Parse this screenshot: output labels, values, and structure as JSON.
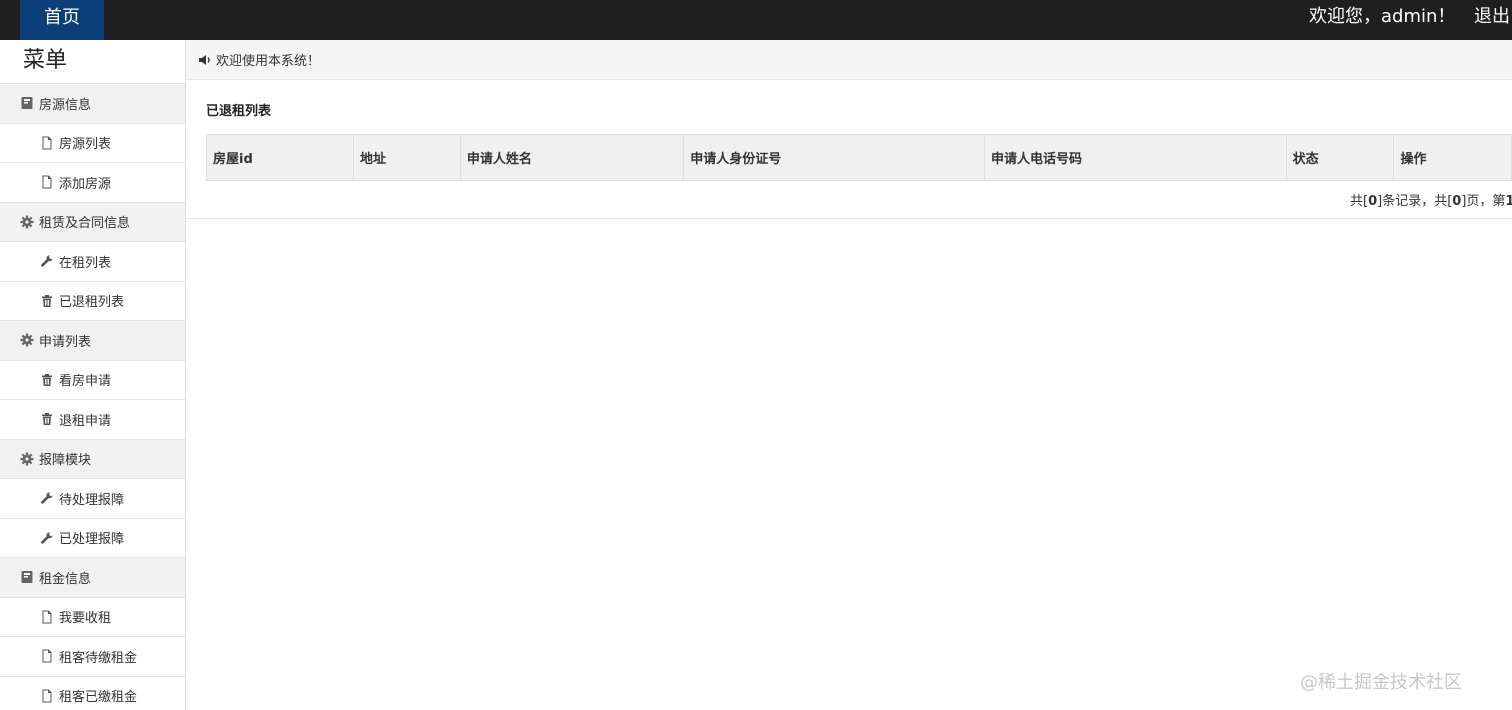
{
  "topbar": {
    "home_label": "首页",
    "welcome_text": "欢迎您，admin！",
    "logout_label": "退出"
  },
  "sidebar": {
    "title": "菜单",
    "items": [
      {
        "label": "房源信息",
        "type": "group",
        "icon": "book-icon"
      },
      {
        "label": "房源列表",
        "type": "item",
        "icon": "file-icon"
      },
      {
        "label": "添加房源",
        "type": "item",
        "icon": "file-icon"
      },
      {
        "label": "租赁及合同信息",
        "type": "group",
        "icon": "gear-icon"
      },
      {
        "label": "在租列表",
        "type": "item",
        "icon": "wrench-icon"
      },
      {
        "label": "已退租列表",
        "type": "item",
        "icon": "trash-icon"
      },
      {
        "label": "申请列表",
        "type": "group",
        "icon": "gear-icon"
      },
      {
        "label": "看房申请",
        "type": "item",
        "icon": "trash-icon"
      },
      {
        "label": "退租申请",
        "type": "item",
        "icon": "trash-icon"
      },
      {
        "label": "报障模块",
        "type": "group",
        "icon": "gear-icon"
      },
      {
        "label": "待处理报障",
        "type": "item",
        "icon": "wrench-icon"
      },
      {
        "label": "已处理报障",
        "type": "item",
        "icon": "wrench-icon"
      },
      {
        "label": "租金信息",
        "type": "group",
        "icon": "book-icon"
      },
      {
        "label": "我要收租",
        "type": "item",
        "icon": "file-icon"
      },
      {
        "label": "租客待缴租金",
        "type": "item",
        "icon": "file-icon"
      },
      {
        "label": "租客已缴租金",
        "type": "item",
        "icon": "file-icon"
      }
    ]
  },
  "notice": {
    "icon": "speaker-icon",
    "text": "欢迎使用本系统！"
  },
  "panel": {
    "title": "已退租列表",
    "columns": [
      "房屋id",
      "地址",
      "申请人姓名",
      "申请人身份证号",
      "申请人电话号码",
      "状态",
      "操作"
    ]
  },
  "pager": {
    "prefix": "共[",
    "records": "0",
    "mid1": "]条记录，共[",
    "pages": "0",
    "mid2": "]页，第",
    "current": "1"
  },
  "watermark": "@稀土掘金技术社区"
}
